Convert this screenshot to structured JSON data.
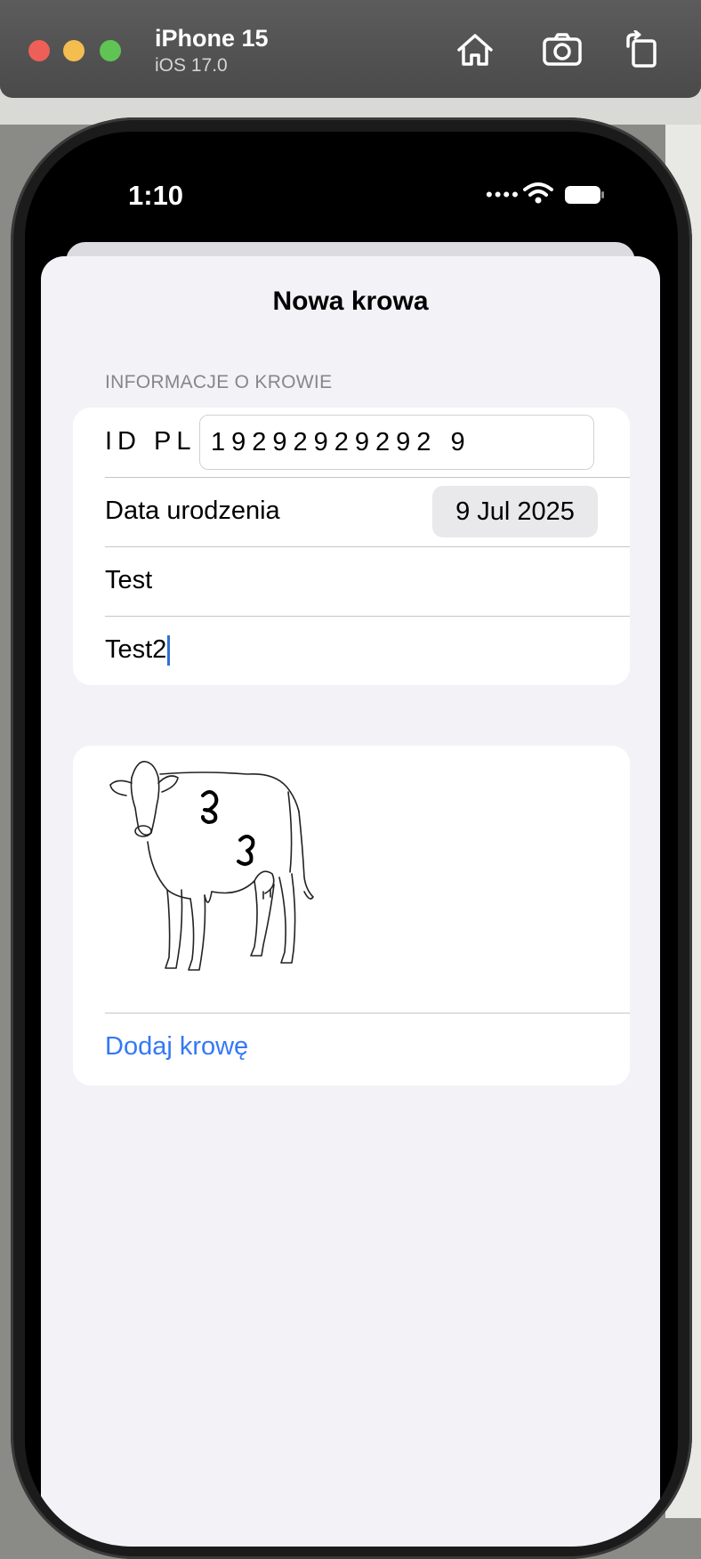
{
  "simulator": {
    "device_name": "iPhone 15",
    "os_version": "iOS 17.0",
    "buttons": [
      "home-icon",
      "camera-icon",
      "rotate-icon"
    ]
  },
  "status_bar": {
    "time": "1:10",
    "signal": "••••"
  },
  "sheet": {
    "title": "Nowa krowa",
    "section_header": "INFORMACJE O KROWIE",
    "id_label": "ID PL",
    "id_value": "19292929292 9",
    "birth_label": "Data urodzenia",
    "birth_date": "9 Jul 2025",
    "field3_value": "Test",
    "field4_value": "Test2",
    "image_icon": "cow-drawing",
    "add_button": "Dodaj krowę"
  },
  "colors": {
    "accent": "#3478f6",
    "sheet_bg": "#f2f2f7",
    "card_bg": "#ffffff"
  }
}
